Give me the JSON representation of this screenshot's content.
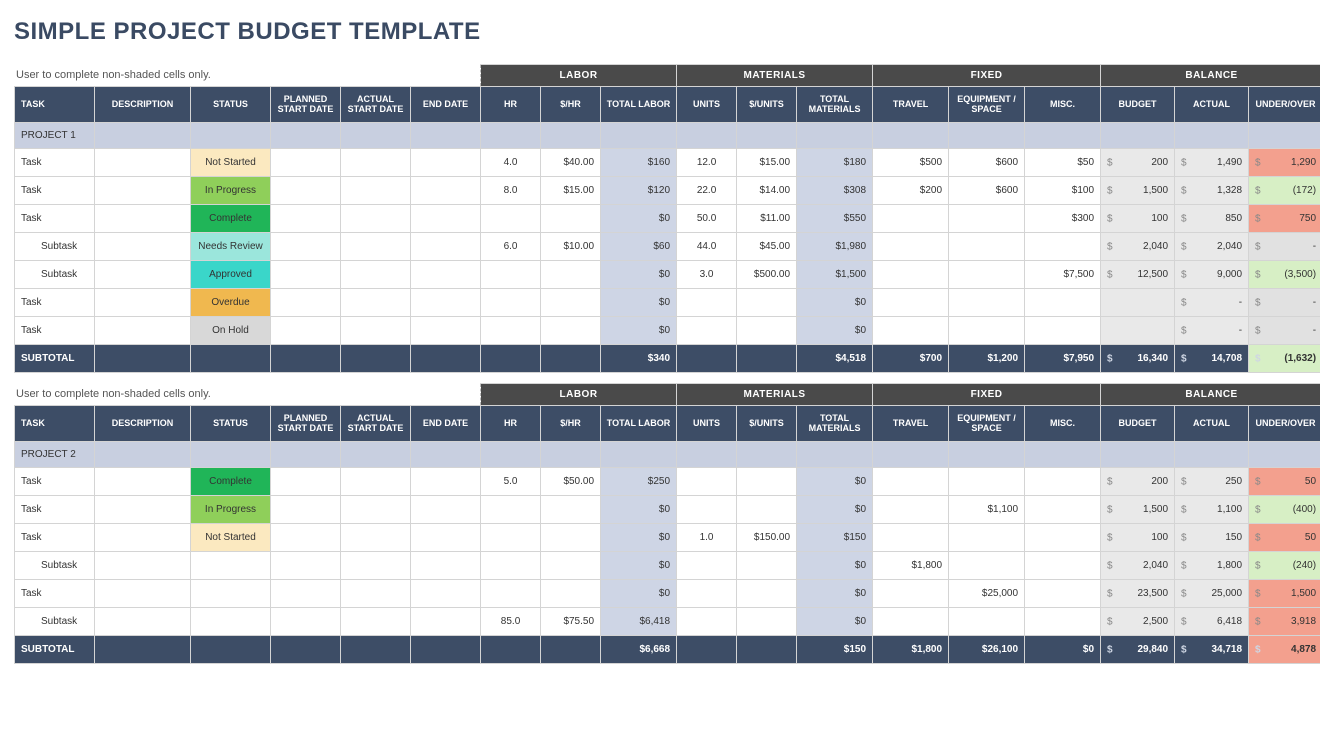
{
  "title": "SIMPLE PROJECT BUDGET TEMPLATE",
  "note": "User to complete non-shaded cells only.",
  "groups": {
    "labor": "LABOR",
    "materials": "MATERIALS",
    "fixed": "FIXED",
    "balance": "BALANCE"
  },
  "headers": {
    "task": "TASK",
    "description": "DESCRIPTION",
    "status": "STATUS",
    "planned": "PLANNED START DATE",
    "actual_start": "ACTUAL START DATE",
    "end": "END DATE",
    "hr": "HR",
    "per_hr": "$/HR",
    "total_labor": "TOTAL LABOR",
    "units": "UNITS",
    "per_unit": "$/UNITS",
    "total_materials": "TOTAL MATERIALS",
    "travel": "TRAVEL",
    "equip": "EQUIPMENT / SPACE",
    "misc": "MISC.",
    "budget": "BUDGET",
    "actual": "ACTUAL",
    "underover": "UNDER/OVER"
  },
  "status_colors": {
    "Not Started": "#fbe9c0",
    "In Progress": "#8fcf5a",
    "Complete": "#20b558",
    "Needs Review": "#9be6dc",
    "Approved": "#3ad6c9",
    "Overdue": "#f0b84f",
    "On Hold": "#d8d8d8"
  },
  "sections": [
    {
      "project_label": "PROJECT 1",
      "rows": [
        {
          "task": "Task",
          "sub": false,
          "status": "Not Started",
          "hr": "4.0",
          "per_hr": "$40.00",
          "total_labor": "$160",
          "units": "12.0",
          "per_unit": "$15.00",
          "total_mat": "$180",
          "travel": "$500",
          "equip": "$600",
          "misc": "$50",
          "budget": "200",
          "actual": "1,490",
          "uo": "1,290",
          "uo_class": "over"
        },
        {
          "task": "Task",
          "sub": false,
          "status": "In Progress",
          "hr": "8.0",
          "per_hr": "$15.00",
          "total_labor": "$120",
          "units": "22.0",
          "per_unit": "$14.00",
          "total_mat": "$308",
          "travel": "$200",
          "equip": "$600",
          "misc": "$100",
          "budget": "1,500",
          "actual": "1,328",
          "uo": "(172)",
          "uo_class": "under"
        },
        {
          "task": "Task",
          "sub": false,
          "status": "Complete",
          "hr": "",
          "per_hr": "",
          "total_labor": "$0",
          "units": "50.0",
          "per_unit": "$11.00",
          "total_mat": "$550",
          "travel": "",
          "equip": "",
          "misc": "$300",
          "budget": "100",
          "actual": "850",
          "uo": "750",
          "uo_class": "over"
        },
        {
          "task": "Subtask",
          "sub": true,
          "status": "Needs Review",
          "hr": "6.0",
          "per_hr": "$10.00",
          "total_labor": "$60",
          "units": "44.0",
          "per_unit": "$45.00",
          "total_mat": "$1,980",
          "travel": "",
          "equip": "",
          "misc": "",
          "budget": "2,040",
          "actual": "2,040",
          "uo": "-",
          "uo_class": "zero"
        },
        {
          "task": "Subtask",
          "sub": true,
          "status": "Approved",
          "hr": "",
          "per_hr": "",
          "total_labor": "$0",
          "units": "3.0",
          "per_unit": "$500.00",
          "total_mat": "$1,500",
          "travel": "",
          "equip": "",
          "misc": "$7,500",
          "budget": "12,500",
          "actual": "9,000",
          "uo": "(3,500)",
          "uo_class": "under"
        },
        {
          "task": "Task",
          "sub": false,
          "status": "Overdue",
          "hr": "",
          "per_hr": "",
          "total_labor": "$0",
          "units": "",
          "per_unit": "",
          "total_mat": "$0",
          "travel": "",
          "equip": "",
          "misc": "",
          "budget": "",
          "actual": "-",
          "uo": "-",
          "uo_class": "zero"
        },
        {
          "task": "Task",
          "sub": false,
          "status": "On Hold",
          "hr": "",
          "per_hr": "",
          "total_labor": "$0",
          "units": "",
          "per_unit": "",
          "total_mat": "$0",
          "travel": "",
          "equip": "",
          "misc": "",
          "budget": "",
          "actual": "-",
          "uo": "-",
          "uo_class": "zero"
        }
      ],
      "subtotal": {
        "label": "SUBTOTAL",
        "total_labor": "$340",
        "total_mat": "$4,518",
        "travel": "$700",
        "equip": "$1,200",
        "misc": "$7,950",
        "budget": "16,340",
        "actual": "14,708",
        "uo": "(1,632)",
        "uo_class": "under"
      }
    },
    {
      "project_label": "PROJECT 2",
      "rows": [
        {
          "task": "Task",
          "sub": false,
          "status": "Complete",
          "hr": "5.0",
          "per_hr": "$50.00",
          "total_labor": "$250",
          "units": "",
          "per_unit": "",
          "total_mat": "$0",
          "travel": "",
          "equip": "",
          "misc": "",
          "budget": "200",
          "actual": "250",
          "uo": "50",
          "uo_class": "over"
        },
        {
          "task": "Task",
          "sub": false,
          "status": "In Progress",
          "hr": "",
          "per_hr": "",
          "total_labor": "$0",
          "units": "",
          "per_unit": "",
          "total_mat": "$0",
          "travel": "",
          "equip": "$1,100",
          "misc": "",
          "budget": "1,500",
          "actual": "1,100",
          "uo": "(400)",
          "uo_class": "under"
        },
        {
          "task": "Task",
          "sub": false,
          "status": "Not Started",
          "hr": "",
          "per_hr": "",
          "total_labor": "$0",
          "units": "1.0",
          "per_unit": "$150.00",
          "total_mat": "$150",
          "travel": "",
          "equip": "",
          "misc": "",
          "budget": "100",
          "actual": "150",
          "uo": "50",
          "uo_class": "over"
        },
        {
          "task": "Subtask",
          "sub": true,
          "status": "",
          "hr": "",
          "per_hr": "",
          "total_labor": "$0",
          "units": "",
          "per_unit": "",
          "total_mat": "$0",
          "travel": "$1,800",
          "equip": "",
          "misc": "",
          "budget": "2,040",
          "actual": "1,800",
          "uo": "(240)",
          "uo_class": "under"
        },
        {
          "task": "Task",
          "sub": false,
          "status": "",
          "hr": "",
          "per_hr": "",
          "total_labor": "$0",
          "units": "",
          "per_unit": "",
          "total_mat": "$0",
          "travel": "",
          "equip": "$25,000",
          "misc": "",
          "budget": "23,500",
          "actual": "25,000",
          "uo": "1,500",
          "uo_class": "over"
        },
        {
          "task": "Subtask",
          "sub": true,
          "status": "",
          "hr": "85.0",
          "per_hr": "$75.50",
          "total_labor": "$6,418",
          "units": "",
          "per_unit": "",
          "total_mat": "$0",
          "travel": "",
          "equip": "",
          "misc": "",
          "budget": "2,500",
          "actual": "6,418",
          "uo": "3,918",
          "uo_class": "over"
        }
      ],
      "subtotal": {
        "label": "SUBTOTAL",
        "total_labor": "$6,668",
        "total_mat": "$150",
        "travel": "$1,800",
        "equip": "$26,100",
        "misc": "$0",
        "budget": "29,840",
        "actual": "34,718",
        "uo": "4,878",
        "uo_class": "over"
      }
    }
  ]
}
